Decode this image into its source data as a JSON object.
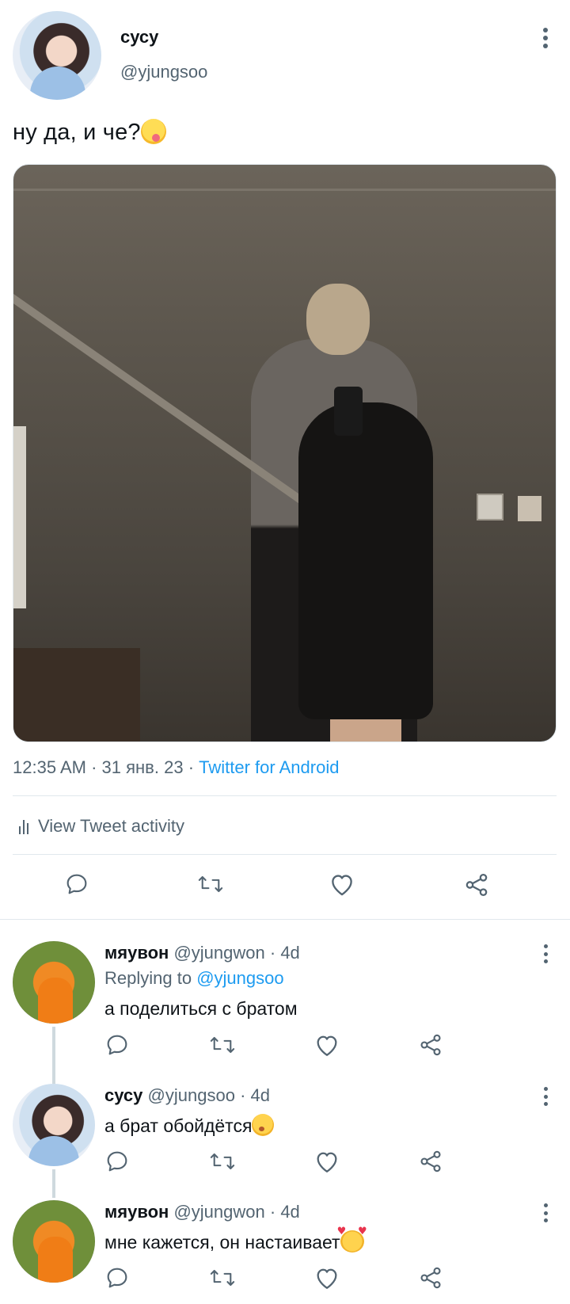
{
  "tweet": {
    "author_name": "сусу",
    "author_handle": "@yjungsoo",
    "text": "ну да, и че?",
    "text_emoji": "yum-emoji",
    "time": "12:35 AM",
    "date": "31 янв. 23",
    "source": "Twitter for Android",
    "activity_label": "View Tweet activity"
  },
  "colors": {
    "link": "#1d9bf0",
    "secondary_text": "#536471",
    "primary_text": "#0f1419",
    "divider": "#e1e8ed"
  },
  "icons": [
    "reply-icon",
    "retweet-icon",
    "like-icon",
    "share-icon",
    "more-icon",
    "analytics-icon"
  ],
  "replies": [
    {
      "author_name": "мяувон",
      "author_handle": "@yjungwon",
      "age": "4d",
      "replying_prefix": "Replying to",
      "replying_to": "@yjungsoo",
      "text": "а поделиться с братом"
    },
    {
      "author_name": "сусу",
      "author_handle": "@yjungsoo",
      "age": "4d",
      "text": "а брат обойдётся",
      "text_emoji": "kissing-emoji"
    },
    {
      "author_name": "мяувон",
      "author_handle": "@yjungwon",
      "age": "4d",
      "text": "мне кажется, он настаивает",
      "text_emoji": "smiling-hearts-emoji"
    }
  ]
}
